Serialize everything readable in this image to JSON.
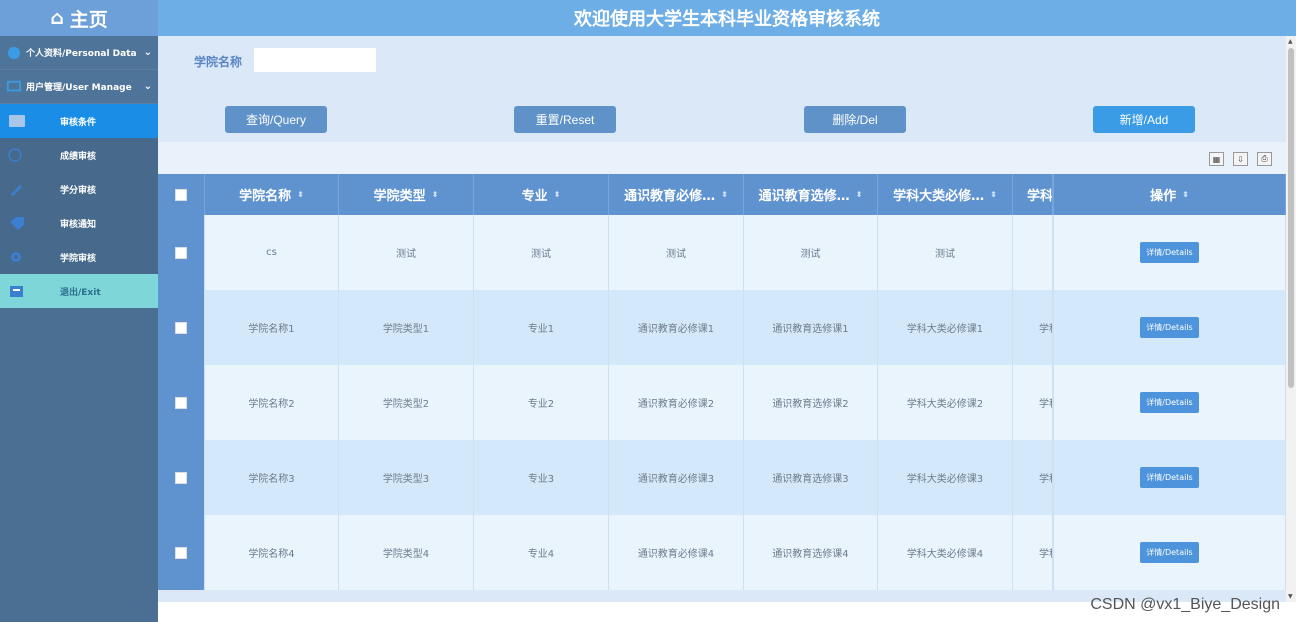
{
  "sidebar": {
    "home_label": "主页",
    "menus": [
      {
        "label": "个人资料/Personal Data"
      },
      {
        "label": "用户管理/User Manage"
      }
    ],
    "items": [
      {
        "label": "审核条件",
        "icon": "id-card-icon"
      },
      {
        "label": "成绩审核",
        "icon": "globe-icon"
      },
      {
        "label": "学分审核",
        "icon": "pencil-icon"
      },
      {
        "label": "审核通知",
        "icon": "tag-icon"
      },
      {
        "label": "学院审核",
        "icon": "gear-icon"
      },
      {
        "label": "退出/Exit",
        "icon": "exit-icon"
      }
    ]
  },
  "header": {
    "title": "欢迎使用大学生本科毕业资格审核系统"
  },
  "search": {
    "label": "学院名称",
    "value": "",
    "placeholder": ""
  },
  "buttons": {
    "query": "查询/Query",
    "reset": "重置/Reset",
    "delete": "删除/Del",
    "add": "新增/Add"
  },
  "table": {
    "columns": [
      "学院名称",
      "学院类型",
      "专业",
      "通识教育必修…",
      "通识教育选修…",
      "学科大类必修…",
      "学科",
      "操作"
    ],
    "detail_label": "详情/Details",
    "rows": [
      [
        "cs",
        "测试",
        "测试",
        "测试",
        "测试",
        "测试",
        ""
      ],
      [
        "学院名称1",
        "学院类型1",
        "专业1",
        "通识教育必修课1",
        "通识教育选修课1",
        "学科大类必修课1",
        "学科"
      ],
      [
        "学院名称2",
        "学院类型2",
        "专业2",
        "通识教育必修课2",
        "通识教育选修课2",
        "学科大类必修课2",
        "学科"
      ],
      [
        "学院名称3",
        "学院类型3",
        "专业3",
        "通识教育必修课3",
        "通识教育选修课3",
        "学科大类必修课3",
        "学科"
      ],
      [
        "学院名称4",
        "学院类型4",
        "专业4",
        "通识教育必修课4",
        "通识教育选修课4",
        "学科大类必修课4",
        "学科"
      ]
    ]
  },
  "watermark": "CSDN @vx1_Biye_Design"
}
